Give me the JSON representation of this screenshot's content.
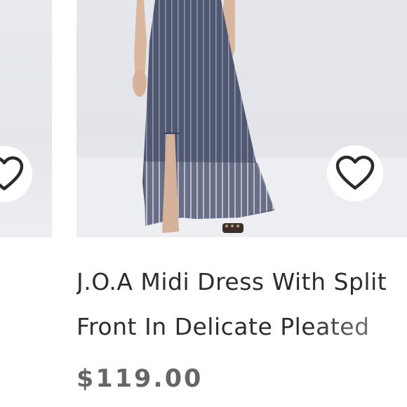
{
  "products": [
    {
      "position": "left-partial",
      "favorite_icon": "heart-outline-icon"
    },
    {
      "position": "main",
      "favorite_icon": "heart-outline-icon",
      "title": "J.O.A Midi Dress With Split Front In Delicate Pleated",
      "price": "$119.00"
    }
  ],
  "colors": {
    "image_background": "#e6e7ec",
    "dress": "#4f5771",
    "title_text": "#2d2d2d",
    "price_text": "#666666",
    "heart_stroke": "#2b2b2b"
  }
}
